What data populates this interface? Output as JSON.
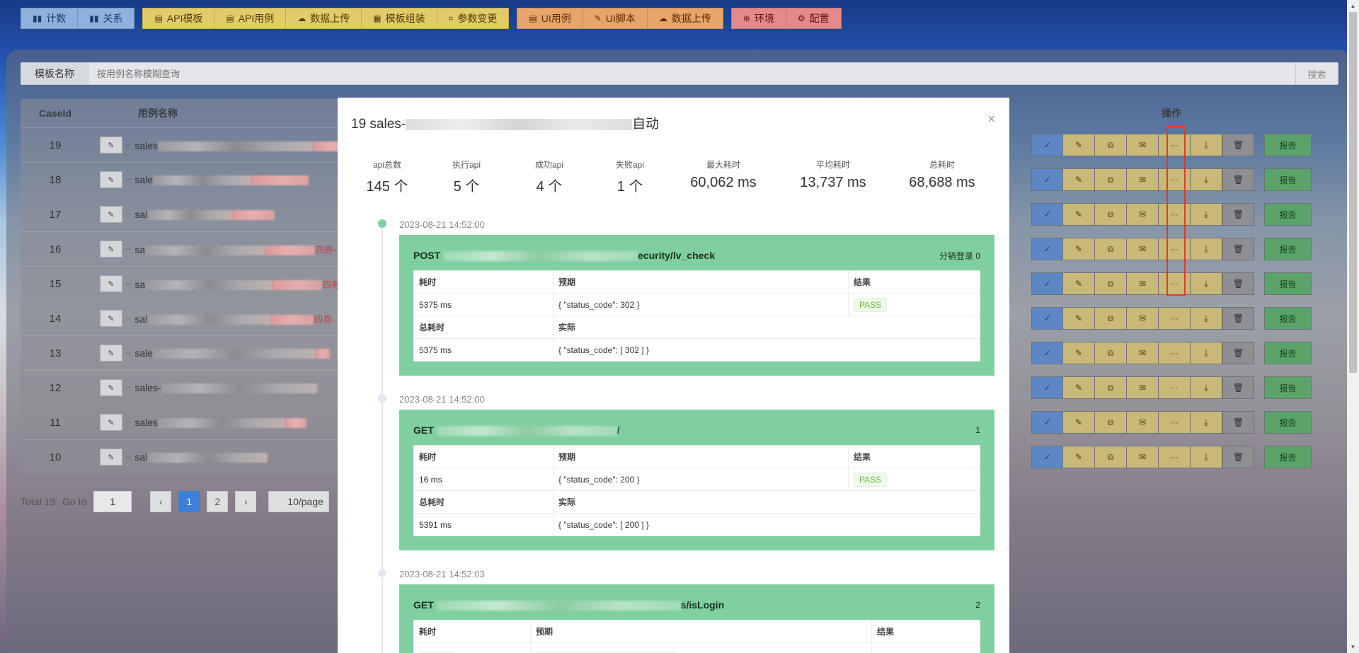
{
  "topnav": {
    "groups": [
      {
        "color": "blue",
        "items": [
          {
            "label": "计数",
            "icon": "bar-chart-icon"
          },
          {
            "label": "关系",
            "icon": "bar-chart-icon"
          }
        ]
      },
      {
        "color": "yellow",
        "items": [
          {
            "label": "API模板",
            "icon": "clipboard-icon"
          },
          {
            "label": "API用例",
            "icon": "clipboard-icon"
          },
          {
            "label": "数据上传",
            "icon": "cloud-upload-icon"
          },
          {
            "label": "模板组装",
            "icon": "grid-icon"
          },
          {
            "label": "参数变更",
            "icon": "crop-icon"
          }
        ]
      },
      {
        "color": "orange",
        "items": [
          {
            "label": "UI用例",
            "icon": "clipboard-icon"
          },
          {
            "label": "UI脚本",
            "icon": "edit-icon"
          },
          {
            "label": "数据上传",
            "icon": "cloud-upload-icon"
          }
        ]
      },
      {
        "color": "red",
        "items": [
          {
            "label": "环境",
            "icon": "circle-plus-icon"
          },
          {
            "label": "配置",
            "icon": "gear-icon"
          }
        ]
      }
    ]
  },
  "search": {
    "label": "模板名称",
    "placeholder": "按用例名称模糊查询",
    "button": "搜索"
  },
  "table": {
    "headers": {
      "id": "CaseId",
      "name": "用例名称",
      "ops": "操作"
    },
    "rows": [
      {
        "id": "19",
        "prefix": "sales",
        "suffix": "、CD"
      },
      {
        "id": "18",
        "prefix": "sale",
        "suffix": ""
      },
      {
        "id": "17",
        "prefix": "sal",
        "suffix": ""
      },
      {
        "id": "16",
        "prefix": "sa",
        "suffix": "四券-"
      },
      {
        "id": "15",
        "prefix": "sa",
        "suffix": "四券-"
      },
      {
        "id": "14",
        "prefix": "sal",
        "suffix": "四券-"
      },
      {
        "id": "13",
        "prefix": "sale",
        "suffix": ""
      },
      {
        "id": "12",
        "prefix": "sales-",
        "suffix": ""
      },
      {
        "id": "11",
        "prefix": "sales",
        "suffix": ""
      },
      {
        "id": "10",
        "prefix": "sal",
        "suffix": ""
      }
    ],
    "report_label": "报告"
  },
  "pager": {
    "total": "Total 19",
    "goto": "Go to",
    "goto_value": "1",
    "pages": [
      "1",
      "2"
    ],
    "prev": "‹",
    "next": "›",
    "size": "10/page"
  },
  "modal": {
    "title_prefix": "19 sales-",
    "title_suffix": "自动",
    "close": "×",
    "stats": [
      {
        "label": "api总数",
        "value": "145 个"
      },
      {
        "label": "执行api",
        "value": "5 个"
      },
      {
        "label": "成功api",
        "value": "4 个"
      },
      {
        "label": "失败api",
        "value": "1 个"
      },
      {
        "label": "最大耗时",
        "value": "60,062 ms"
      },
      {
        "label": "平均耗时",
        "value": "13,737 ms"
      },
      {
        "label": "总耗时",
        "value": "68,688 ms"
      }
    ],
    "entries": [
      {
        "time": "2023-08-21 14:52:00",
        "method": "POST",
        "path_tail": "ecurity/lv_check",
        "right": "分销登录 0",
        "headers1": [
          "耗时",
          "预期",
          "结果"
        ],
        "cost": "5375 ms",
        "expected": "{ \"status_code\": 302 }",
        "result": "PASS",
        "headers2": [
          "总耗时",
          "实际"
        ],
        "total_cost": "5375 ms",
        "actual": "{ \"status_code\": [ 302 ] }"
      },
      {
        "time": "2023-08-21 14:52:00",
        "method": "GET",
        "path_tail": "/",
        "right": "1",
        "headers1": [
          "耗时",
          "预期",
          "结果"
        ],
        "cost": "16 ms",
        "expected": "{ \"status_code\": 200 }",
        "result": "PASS",
        "headers2": [
          "总耗时",
          "实际"
        ],
        "total_cost": "5391 ms",
        "actual": "{ \"status_code\": [ 200 ] }"
      },
      {
        "time": "2023-08-21 14:52:03",
        "method": "GET",
        "path_tail": "s/isLogin",
        "right": "2",
        "headers1": [
          "耗时",
          "预期",
          "结果"
        ]
      }
    ]
  }
}
